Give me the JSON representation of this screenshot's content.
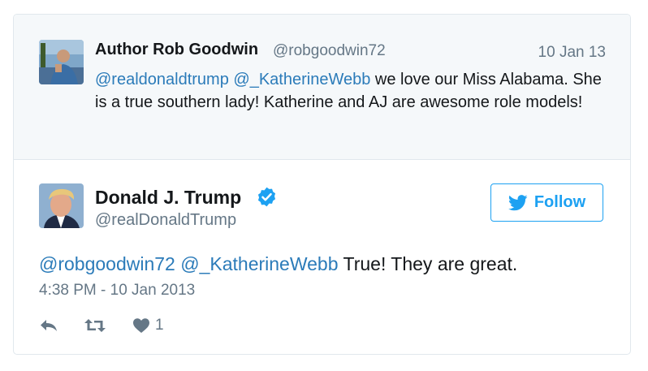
{
  "parent_tweet": {
    "author_name": "Author Rob Goodwin",
    "author_handle": "@robgoodwin72",
    "date": "10 Jan 13",
    "mention_1": "@realdonaldtrump",
    "mention_2": "@_KatherineWebb",
    "text": "we love our Miss Alabama. She is a true southern lady! Katherine and AJ are awesome role models!"
  },
  "main_tweet": {
    "author_name": "Donald J. Trump",
    "author_handle": "@realDonaldTrump",
    "follow_label": "Follow",
    "mention_1": "@robgoodwin72",
    "mention_2": "@_KatherineWebb",
    "text": "True! They are great.",
    "timestamp": "4:38 PM - 10 Jan 2013",
    "like_count": "1"
  },
  "colors": {
    "link": "#2b7bb9",
    "twitter_blue": "#1da1f2",
    "muted": "#657786",
    "parent_bg": "#f5f8fa"
  },
  "icons": {
    "verified": "verified-badge-icon",
    "follow": "twitter-bird-icon",
    "reply": "reply-icon",
    "retweet": "retweet-icon",
    "like": "heart-icon"
  }
}
